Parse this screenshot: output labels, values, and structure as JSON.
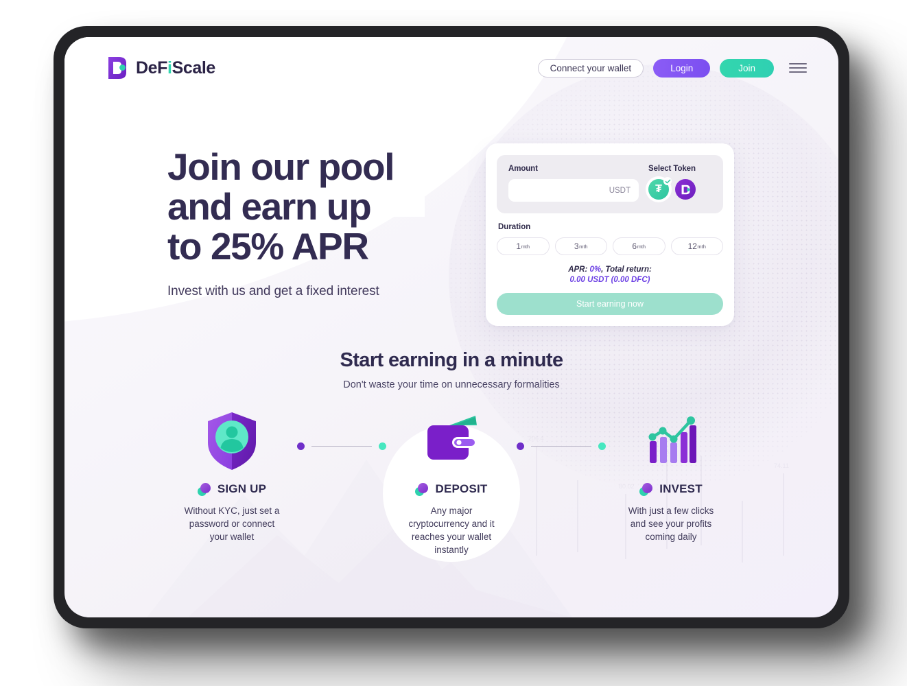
{
  "brand": {
    "name_prefix": "DeF",
    "name_i": "i",
    "name_suffix": "Scale",
    "full_name": "DeFiScale"
  },
  "header": {
    "connect_wallet_label": "Connect your wallet",
    "login_label": "Login",
    "join_label": "Join",
    "menu_icon": "hamburger-menu-icon"
  },
  "hero": {
    "title_line1": "Join our pool",
    "title_line2": "and earn up",
    "title_line3": "to 25% APR",
    "subtitle": "Invest with us and get a fixed interest"
  },
  "calculator": {
    "amount_label": "Amount",
    "amount_value": "",
    "amount_placeholder": "",
    "amount_unit": "USDT",
    "select_token_label": "Select Token",
    "tokens": [
      {
        "symbol": "USDT",
        "glyph": "₮",
        "icon": "tether-token-icon",
        "selected": true,
        "color": "#2ec5a0"
      },
      {
        "symbol": "DFC",
        "glyph": "D",
        "icon": "dfc-token-icon",
        "selected": false,
        "color": "#6d1fbe"
      }
    ],
    "duration_label": "Duration",
    "durations": [
      {
        "num": "1",
        "unit": "mth"
      },
      {
        "num": "3",
        "unit": "mth"
      },
      {
        "num": "6",
        "unit": "mth"
      },
      {
        "num": "12",
        "unit": "mth"
      }
    ],
    "apr_prefix": "APR: ",
    "apr_value": "0%",
    "apr_mid": ", Total return:",
    "total_return": "0.00 USDT (0.00 DFC)",
    "cta_label": "Start earning now",
    "accent_purple": "#6c40e4",
    "cta_color": "#9de0cd"
  },
  "steps_section": {
    "heading": "Start earning in a minute",
    "subheading": "Don't waste your time on unnecessary formalities",
    "steps": [
      {
        "title": "SIGN UP",
        "desc": "Without KYC, just set a password or connect your wallet",
        "icon": "shield-user-icon"
      },
      {
        "title": "DEPOSIT",
        "desc": "Any major cryptocurrency and it reaches your wallet instantly",
        "icon": "wallet-icon"
      },
      {
        "title": "INVEST",
        "desc": "With just a few clicks and see your profits coming daily",
        "icon": "growth-chart-icon"
      }
    ]
  },
  "theme": {
    "brand_purple": "#7b3fe4",
    "brand_teal": "#2ed2ae",
    "text_dark": "#2f2a4f"
  }
}
